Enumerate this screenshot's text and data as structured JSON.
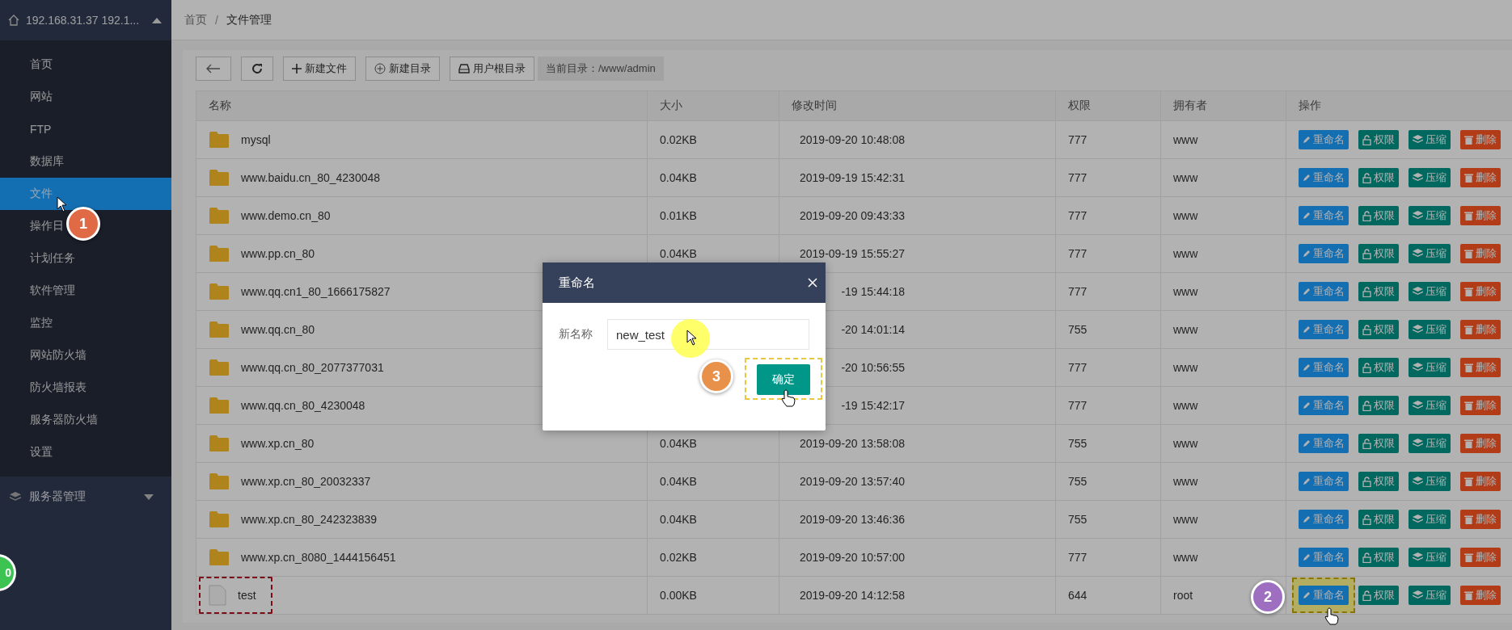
{
  "sidebar": {
    "server": "192.168.31.37 192.1...",
    "items": [
      {
        "label": "首页",
        "selected": false
      },
      {
        "label": "网站",
        "selected": false
      },
      {
        "label": "FTP",
        "selected": false
      },
      {
        "label": "数据库",
        "selected": false
      },
      {
        "label": "文件",
        "selected": true
      },
      {
        "label": "操作日",
        "selected": false
      },
      {
        "label": "计划任务",
        "selected": false
      },
      {
        "label": "软件管理",
        "selected": false
      },
      {
        "label": "监控",
        "selected": false
      },
      {
        "label": "网站防火墙",
        "selected": false
      },
      {
        "label": "防火墙报表",
        "selected": false
      },
      {
        "label": "服务器防火墙",
        "selected": false
      },
      {
        "label": "设置",
        "selected": false
      }
    ],
    "group": "服务器管理",
    "edge_badge": "0"
  },
  "breadcrumb": {
    "items": [
      "首页",
      "文件管理"
    ],
    "separator": "/"
  },
  "toolbar": {
    "buttons": [
      {
        "kind": "back"
      },
      {
        "kind": "refresh"
      },
      {
        "kind": "new-file",
        "label": "新建文件"
      },
      {
        "kind": "new-dir",
        "label": "新建目录"
      },
      {
        "kind": "home-dir",
        "label": "用户根目录"
      }
    ],
    "current_dir": "当前目录：/www/admin"
  },
  "table": {
    "columns": [
      "名称",
      "大小",
      "修改时间",
      "权限",
      "拥有者",
      "操作"
    ],
    "rows": [
      {
        "kind": "folder",
        "name": "mysql",
        "size": "0.02KB",
        "modified": "2019-09-20 10:48:08",
        "permissions": "777",
        "owner": "www",
        "marked": false,
        "actions": [
          {
            "kind": "rename",
            "label": "重命名",
            "marked": false
          },
          {
            "kind": "perm",
            "label": "权限"
          },
          {
            "kind": "zip",
            "label": "压缩"
          },
          {
            "kind": "delete",
            "label": "删除"
          }
        ]
      },
      {
        "kind": "folder",
        "name": "www.baidu.cn_80_4230048",
        "size": "0.04KB",
        "modified": "2019-09-19 15:42:31",
        "permissions": "777",
        "owner": "www",
        "marked": false,
        "actions": [
          {
            "kind": "rename",
            "label": "重命名",
            "marked": false
          },
          {
            "kind": "perm",
            "label": "权限"
          },
          {
            "kind": "zip",
            "label": "压缩"
          },
          {
            "kind": "delete",
            "label": "删除"
          }
        ]
      },
      {
        "kind": "folder",
        "name": "www.demo.cn_80",
        "size": "0.01KB",
        "modified": "2019-09-20 09:43:33",
        "permissions": "777",
        "owner": "www",
        "marked": false,
        "actions": [
          {
            "kind": "rename",
            "label": "重命名",
            "marked": false
          },
          {
            "kind": "perm",
            "label": "权限"
          },
          {
            "kind": "zip",
            "label": "压缩"
          },
          {
            "kind": "delete",
            "label": "删除"
          }
        ]
      },
      {
        "kind": "folder",
        "name": "www.pp.cn_80",
        "size": "0.04KB",
        "modified": "2019-09-19 15:55:27",
        "permissions": "777",
        "owner": "www",
        "marked": false,
        "actions": [
          {
            "kind": "rename",
            "label": "重命名",
            "marked": false
          },
          {
            "kind": "perm",
            "label": "权限"
          },
          {
            "kind": "zip",
            "label": "压缩"
          },
          {
            "kind": "delete",
            "label": "删除"
          }
        ]
      },
      {
        "kind": "folder",
        "name": "www.qq.cn1_80_1666175827",
        "modified": "-19 15:44:18",
        "permissions": "777",
        "owner": "www",
        "marked": false,
        "actions": [
          {
            "kind": "rename",
            "label": "重命名",
            "marked": false
          },
          {
            "kind": "perm",
            "label": "权限"
          },
          {
            "kind": "zip",
            "label": "压缩"
          },
          {
            "kind": "delete",
            "label": "删除"
          }
        ]
      },
      {
        "kind": "folder",
        "name": "www.qq.cn_80",
        "modified": "-20 14:01:14",
        "permissions": "755",
        "owner": "www",
        "marked": false,
        "actions": [
          {
            "kind": "rename",
            "label": "重命名",
            "marked": false
          },
          {
            "kind": "perm",
            "label": "权限"
          },
          {
            "kind": "zip",
            "label": "压缩"
          },
          {
            "kind": "delete",
            "label": "删除"
          }
        ]
      },
      {
        "kind": "folder",
        "name": "www.qq.cn_80_2077377031",
        "modified": "-20 10:56:55",
        "permissions": "777",
        "owner": "www",
        "marked": false,
        "actions": [
          {
            "kind": "rename",
            "label": "重命名",
            "marked": false
          },
          {
            "kind": "perm",
            "label": "权限"
          },
          {
            "kind": "zip",
            "label": "压缩"
          },
          {
            "kind": "delete",
            "label": "删除"
          }
        ]
      },
      {
        "kind": "folder",
        "name": "www.qq.cn_80_4230048",
        "modified": "-19 15:42:17",
        "permissions": "777",
        "owner": "www",
        "marked": false,
        "actions": [
          {
            "kind": "rename",
            "label": "重命名",
            "marked": false
          },
          {
            "kind": "perm",
            "label": "权限"
          },
          {
            "kind": "zip",
            "label": "压缩"
          },
          {
            "kind": "delete",
            "label": "删除"
          }
        ]
      },
      {
        "kind": "folder",
        "name": "www.xp.cn_80",
        "size": "0.04KB",
        "modified": "2019-09-20 13:58:08",
        "permissions": "755",
        "owner": "www",
        "marked": false,
        "actions": [
          {
            "kind": "rename",
            "label": "重命名",
            "marked": false
          },
          {
            "kind": "perm",
            "label": "权限"
          },
          {
            "kind": "zip",
            "label": "压缩"
          },
          {
            "kind": "delete",
            "label": "删除"
          }
        ]
      },
      {
        "kind": "folder",
        "name": "www.xp.cn_80_20032337",
        "size": "0.04KB",
        "modified": "2019-09-20 13:57:40",
        "permissions": "755",
        "owner": "www",
        "marked": false,
        "actions": [
          {
            "kind": "rename",
            "label": "重命名",
            "marked": false
          },
          {
            "kind": "perm",
            "label": "权限"
          },
          {
            "kind": "zip",
            "label": "压缩"
          },
          {
            "kind": "delete",
            "label": "删除"
          }
        ]
      },
      {
        "kind": "folder",
        "name": "www.xp.cn_80_242323839",
        "size": "0.04KB",
        "modified": "2019-09-20 13:46:36",
        "permissions": "755",
        "owner": "www",
        "marked": false,
        "actions": [
          {
            "kind": "rename",
            "label": "重命名",
            "marked": false
          },
          {
            "kind": "perm",
            "label": "权限"
          },
          {
            "kind": "zip",
            "label": "压缩"
          },
          {
            "kind": "delete",
            "label": "删除"
          }
        ]
      },
      {
        "kind": "folder",
        "name": "www.xp.cn_8080_1444156451",
        "size": "0.02KB",
        "modified": "2019-09-20 10:57:00",
        "permissions": "777",
        "owner": "www",
        "marked": false,
        "actions": [
          {
            "kind": "rename",
            "label": "重命名",
            "marked": false
          },
          {
            "kind": "perm",
            "label": "权限"
          },
          {
            "kind": "zip",
            "label": "压缩"
          },
          {
            "kind": "delete",
            "label": "删除"
          }
        ]
      },
      {
        "kind": "file",
        "name": "test",
        "size": "0.00KB",
        "modified": "2019-09-20 14:12:58",
        "permissions": "644",
        "owner": "root",
        "marked": true,
        "actions": [
          {
            "kind": "rename",
            "label": "重命名",
            "marked": true
          },
          {
            "kind": "perm",
            "label": "权限"
          },
          {
            "kind": "zip",
            "label": "压缩"
          },
          {
            "kind": "delete",
            "label": "删除"
          }
        ]
      }
    ]
  },
  "modal": {
    "title": "重命名",
    "field_label": "新名称",
    "value": "new_test",
    "confirm": "确定",
    "confirm_marked": true
  },
  "steps": [
    {
      "kind": "sidebar",
      "label": "1"
    },
    {
      "kind": "row-action",
      "label": "2"
    },
    {
      "kind": "modal",
      "label": "3"
    }
  ]
}
